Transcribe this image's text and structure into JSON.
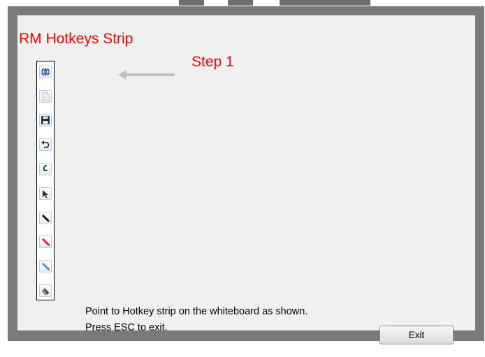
{
  "title": "RM Hotkeys Strip",
  "step_label": "Step 1",
  "hotkeys": [
    {
      "icon": "globe-icon"
    },
    {
      "icon": "blank-page-icon"
    },
    {
      "icon": "save-icon"
    },
    {
      "icon": "undo-icon"
    },
    {
      "icon": "redo-icon"
    },
    {
      "icon": "pointer-arrow-icon"
    },
    {
      "icon": "black-pen-icon"
    },
    {
      "icon": "red-pen-icon"
    },
    {
      "icon": "blue-highlighter-icon"
    },
    {
      "icon": "eraser-icon"
    }
  ],
  "instructions": {
    "line1": "Point to Hotkey strip on the whiteboard as shown.",
    "line2": "Press ESC to exit."
  },
  "exit_label": "Exit",
  "colors": {
    "heading": "#ff0000",
    "frame": "#7a7a7a",
    "panel": "#f0f0f0",
    "arrow": "#c0c0c0"
  }
}
